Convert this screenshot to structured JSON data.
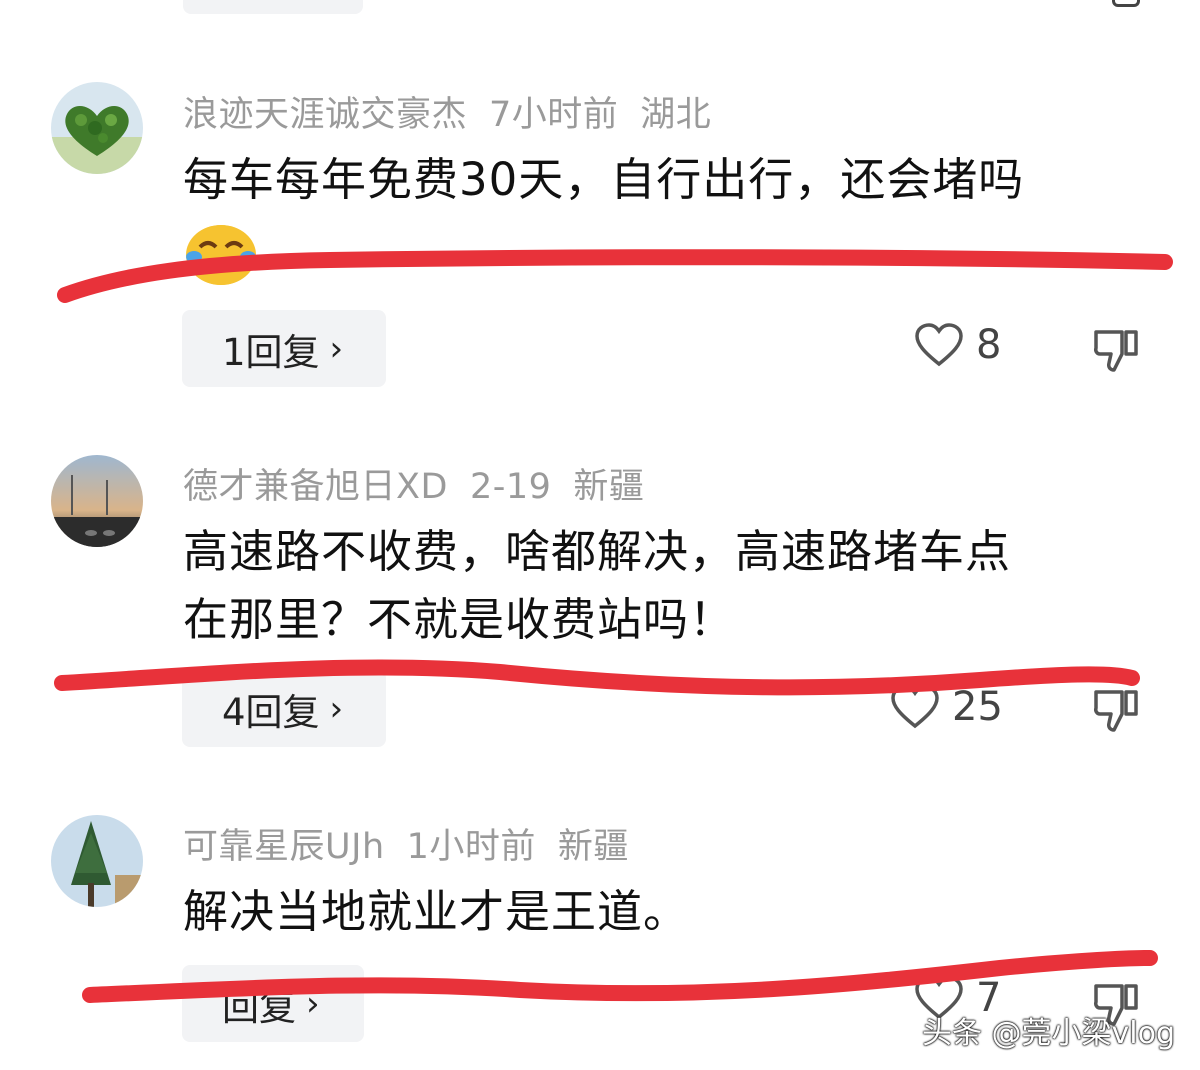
{
  "comments": [
    {
      "username": "浪迹天涯诚交豪杰",
      "time": "7小时前",
      "location": "湖北",
      "content": "每车每年免费30天，自行出行，还会堵吗",
      "replies_label": "1回复",
      "likes": "8",
      "avatar_icon": "heart-shaped-forest-avatar"
    },
    {
      "username": "德才兼备旭日XD",
      "time": "2-19",
      "location": "新疆",
      "content_line1": "高速路不收费，啥都解决，高速路堵车点",
      "content_line2": "在那里？不就是收费站吗！",
      "replies_label": "4回复",
      "likes": "25",
      "avatar_icon": "highway-sunset-avatar"
    },
    {
      "username": "可靠星辰UJh",
      "time": "1小时前",
      "location": "新疆",
      "content": "解决当地就业才是王道。",
      "replies_label": "回复",
      "likes": "7",
      "avatar_icon": "pine-tree-avatar"
    }
  ],
  "icons": {
    "like": "heart-outline-icon",
    "dislike": "thumbs-down-icon",
    "chevron": "chevron-right-icon",
    "emoji": "laughing-crying-emoji"
  },
  "colors": {
    "annotation_red": "#e8323a",
    "meta_gray": "#9a9a9a",
    "button_bg": "#f2f3f5"
  },
  "chevron_char": "›",
  "watermark": "头条 @莞小梁vlog"
}
